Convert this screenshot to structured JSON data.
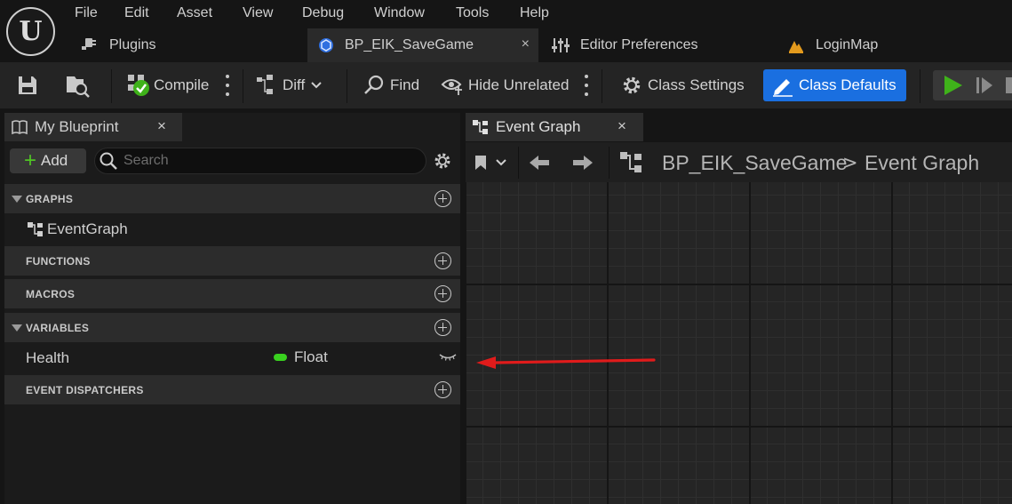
{
  "menu": {
    "file": "File",
    "edit": "Edit",
    "asset": "Asset",
    "view": "View",
    "debug": "Debug",
    "window": "Window",
    "tools": "Tools",
    "help": "Help"
  },
  "logo": {
    "glyph": "U"
  },
  "tabs": {
    "plugins": "Plugins",
    "bp_savegame": "BP_EIK_SaveGame",
    "close_glyph": "×",
    "editor_prefs": "Editor Preferences",
    "login_map": "LoginMap"
  },
  "toolbar": {
    "compile": "Compile",
    "diff": "Diff",
    "find": "Find",
    "hide_unrelated": "Hide Unrelated",
    "class_settings": "Class Settings",
    "class_defaults": "Class Defaults"
  },
  "my_blueprint": {
    "tab_label": "My Blueprint",
    "close_glyph": "×",
    "add_label": "Add",
    "add_glyph": "+",
    "search_placeholder": "Search",
    "sections": {
      "graphs": "GRAPHS",
      "functions": "FUNCTIONS",
      "macros": "MACROS",
      "variables": "VARIABLES",
      "event_dispatchers": "EVENT DISPATCHERS"
    },
    "graph_item": "EventGraph",
    "variable": {
      "name": "Health",
      "type": "Float",
      "type_color": "#39d11f"
    }
  },
  "event_graph": {
    "tab_label": "Event Graph",
    "close_glyph": "×",
    "breadcrumb_blueprint": "BP_EIK_SaveGame",
    "breadcrumb_separator": ">",
    "breadcrumb_graph": "Event Graph"
  },
  "colors": {
    "accent": "#1a6fe0",
    "annotation_arrow": "#e01b1b",
    "float_pin": "#39d11f"
  }
}
